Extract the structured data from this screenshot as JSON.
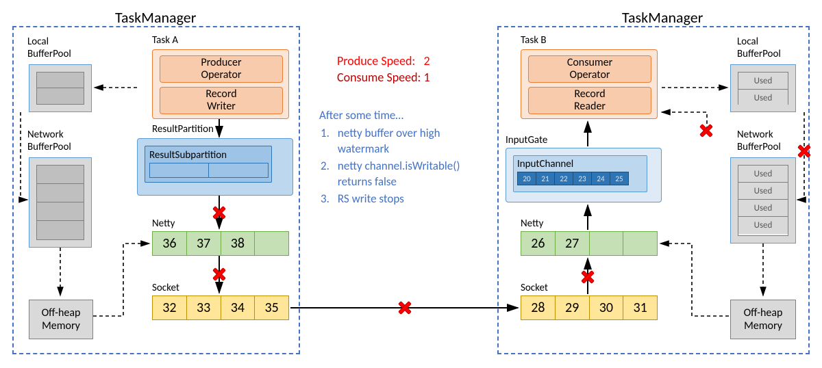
{
  "left": {
    "title": "TaskManager",
    "localPoolLabel": "Local\nBufferPool",
    "networkPoolLabel": "Network\nBufferPool",
    "offheap": "Off-heap\nMemory",
    "taskLabel": "Task A",
    "producer": "Producer\nOperator",
    "writer": "Record\nWriter",
    "resultPartitionLabel": "ResultPartition",
    "resultSubLabel": "ResultSubpartition",
    "nettyLabel": "Netty",
    "nettyCells": [
      "36",
      "37",
      "38",
      ""
    ],
    "socketLabel": "Socket",
    "socketCells": [
      "32",
      "33",
      "34",
      "35"
    ]
  },
  "center": {
    "produceLabel": "Produce Speed:",
    "produceVal": "2",
    "consumeLabel": "Consume Speed:",
    "consumeVal": "1",
    "noteTitle": "After some time…",
    "notes": [
      "netty buffer over high watermark",
      "netty channel.isWritable() returns false",
      "RS write stops"
    ]
  },
  "right": {
    "title": "TaskManager",
    "taskLabel": "Task B",
    "consumer": "Consumer\nOperator",
    "reader": "Record\nReader",
    "inputGateLabel": "InputGate",
    "inputChannelLabel": "InputChannel",
    "inputChannelCells": [
      "20",
      "21",
      "22",
      "23",
      "24",
      "25"
    ],
    "nettyLabel": "Netty",
    "nettyCells": [
      "26",
      "27",
      "",
      ""
    ],
    "socketLabel": "Socket",
    "socketCells": [
      "28",
      "29",
      "30",
      "31"
    ],
    "localPoolLabel": "Local\nBufferPool",
    "localUsed": [
      "Used",
      "Used"
    ],
    "networkPoolLabel": "Network\nBufferPool",
    "networkUsed": [
      "Used",
      "Used",
      "Used",
      "Used"
    ],
    "offheap": "Off-heap\nMemory"
  }
}
